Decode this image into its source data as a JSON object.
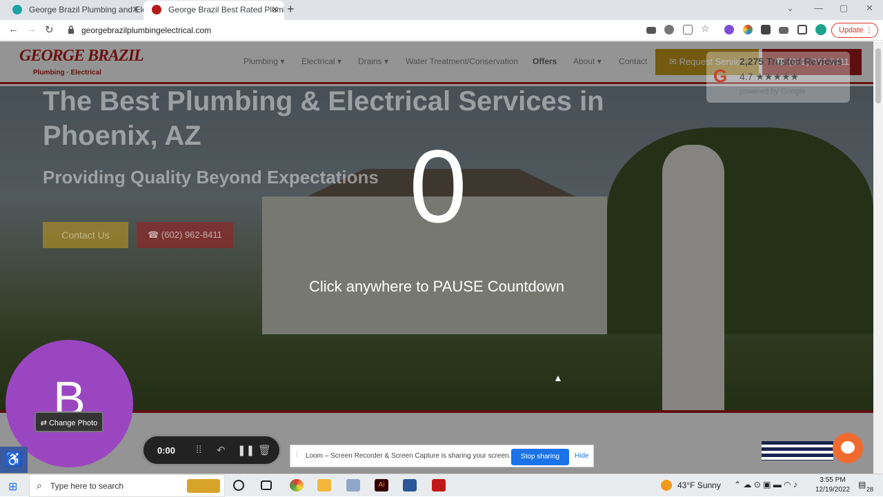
{
  "browser": {
    "tabs": [
      {
        "label": "George Brazil Plumbing and Elec"
      },
      {
        "label": "George Brazil Best Rated Plumbi"
      }
    ],
    "new_tab": "+",
    "url": "georgebrazilplumbingelectrical.com",
    "update_label": "Update"
  },
  "site": {
    "logo_main": "GEORGE BRAZIL",
    "logo_sub": "Plumbing · Electrical",
    "nav": [
      "Plumbing ▾",
      "Electrical ▾",
      "Drains ▾",
      "Water Treatment/Conservation",
      "Offers",
      "About ▾",
      "Contact"
    ],
    "request_label": "✉ Request Service",
    "phone_label": "☎ (602) 962-8411",
    "hero_title": "The Best Plumbing & Electrical Services in Phoenix, AZ",
    "hero_subtitle": "Providing Quality Beyond Expectations",
    "contact_btn": "Contact Us",
    "hero_phone": "☎ (602) 962-8411",
    "reviews": {
      "count": "2,275 Trusted Reviews",
      "rating": "4.7 ★★★★★",
      "powered": "powered by Google"
    }
  },
  "recorder": {
    "countdown": "0",
    "pause_text": "Click anywhere to PAUSE Countdown",
    "avatar_letter": "B",
    "change_photo": "⇄ Change Photo",
    "timer": "0:00",
    "sharing_text": "Loom – Screen Recorder & Screen Capture is sharing your screen.",
    "stop_label": "Stop sharing",
    "hide_label": "Hide"
  },
  "taskbar": {
    "search_placeholder": "Type here to search",
    "weather": "43°F  Sunny",
    "time": "3:55 PM",
    "date": "12/19/2022",
    "notif_count": "28"
  },
  "colors": {
    "brand_red": "#a11a1a",
    "brand_gold": "#c79b1c",
    "loom_purple": "#9b46c1",
    "accent_blue": "#1a73e8"
  }
}
